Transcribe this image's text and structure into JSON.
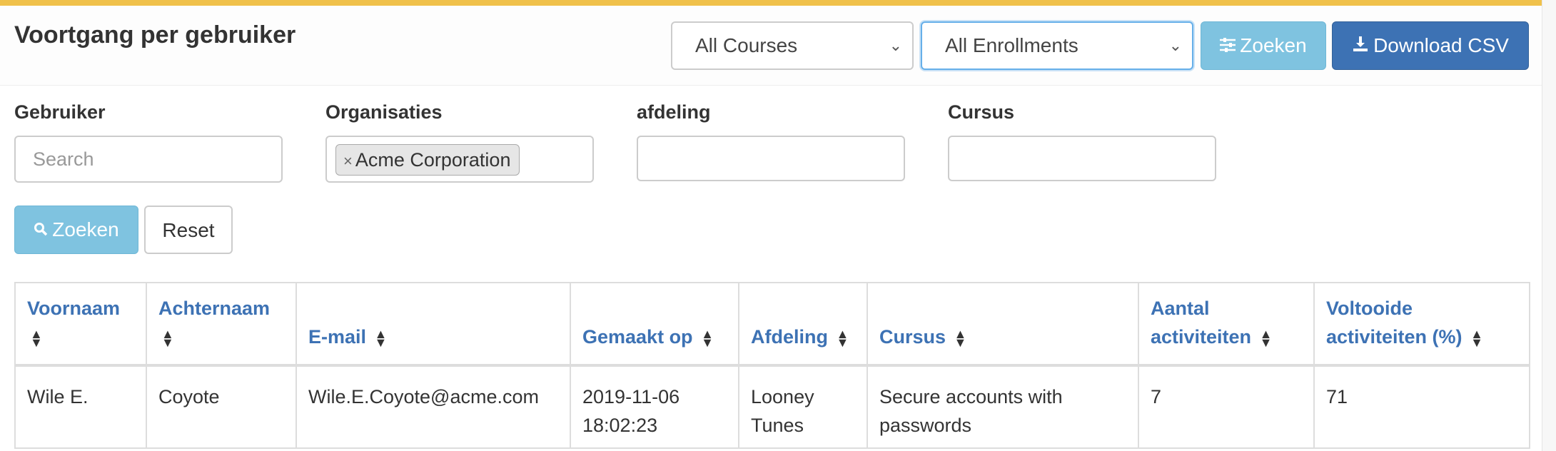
{
  "header": {
    "title": "Voortgang per gebruiker",
    "course_select": "All Courses",
    "enrollment_select": "All Enrollments",
    "filter_button": "Zoeken",
    "download_button": "Download CSV"
  },
  "filters": {
    "user_label": "Gebruiker",
    "user_placeholder": "Search",
    "org_label": "Organisaties",
    "org_tag": "Acme Corporation",
    "dept_label": "afdeling",
    "course_label": "Cursus",
    "search_button": "Zoeken",
    "reset_button": "Reset"
  },
  "table": {
    "columns": [
      "Voornaam",
      "Achternaam",
      "E-mail",
      "Gemaakt op",
      "Afdeling",
      "Cursus",
      "Aantal activiteiten",
      "Voltooide activiteiten (%)"
    ],
    "rows": [
      [
        "Wile E.",
        "Coyote",
        "Wile.E.Coyote@acme.com",
        "2019-11-06 18:02:23",
        "Looney Tunes",
        "Secure accounts with passwords",
        "7",
        "71"
      ]
    ]
  },
  "colors": {
    "accent": "#3d72b4",
    "info_button": "#7fc3e0",
    "top_border": "#f0c14b"
  }
}
